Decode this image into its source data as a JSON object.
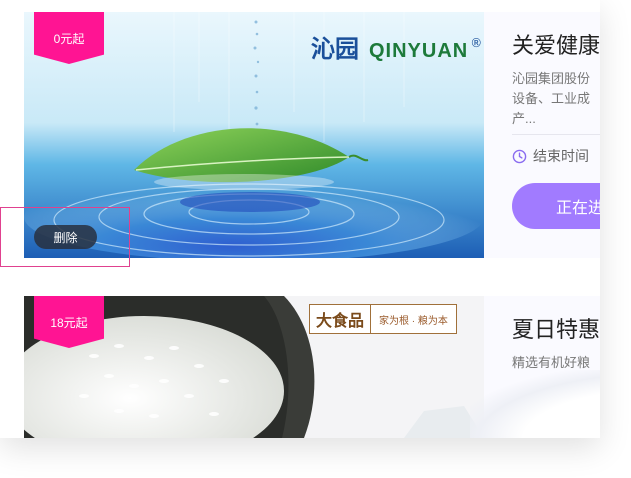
{
  "cards": [
    {
      "badge": "0元起",
      "delete_label": "删除",
      "brand_logo": {
        "cn": "沁园",
        "en": "QINYUAN",
        "reg": "®"
      },
      "title": "关爱健康",
      "description": [
        "沁园集团股份",
        "设备、工业成",
        "产..."
      ],
      "end_time_label": "结束时间",
      "status_label": "正在进"
    },
    {
      "badge": "18元起",
      "brand_logo": {
        "main": "大食品",
        "tagline": "家为根 · 粮为本"
      },
      "title": "夏日特惠",
      "description": [
        "精选有机好粮"
      ]
    }
  ],
  "colors": {
    "badge": "#ff1493",
    "status_button": "#a17bff",
    "delete_button": "#283040",
    "highlight_border": "#e0418f"
  },
  "icons": {
    "clock": "clock-icon"
  }
}
